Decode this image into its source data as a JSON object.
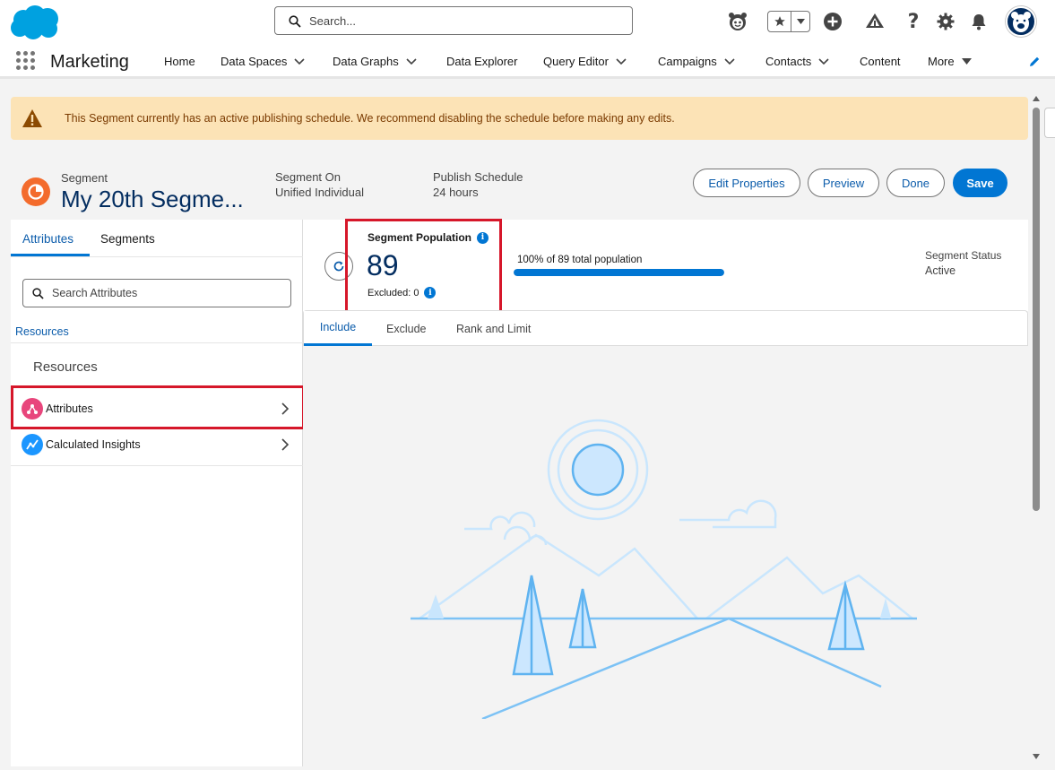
{
  "header": {
    "search_placeholder": "Search...",
    "icons": [
      "salesforce-logo",
      "einstein-icon",
      "favorites-star-icon",
      "add-icon",
      "setup-trailhead-icon",
      "help-icon",
      "gear-icon",
      "notification-bell-icon",
      "user-avatar"
    ]
  },
  "nav": {
    "app_name": "Marketing",
    "items": [
      {
        "label": "Home"
      },
      {
        "label": "Data Spaces"
      },
      {
        "label": "Data Graphs"
      },
      {
        "label": "Data Explorer"
      },
      {
        "label": "Query Editor"
      },
      {
        "label": "Campaigns"
      },
      {
        "label": "Contacts"
      },
      {
        "label": "Content"
      },
      {
        "label": "More"
      }
    ]
  },
  "alert": {
    "text": "This Segment currently has an active publishing schedule. We recommend disabling the schedule before making any edits."
  },
  "record": {
    "type": "Segment",
    "title": "My 20th Segme...",
    "fields": [
      {
        "label": "Segment On",
        "value": "Unified Individual"
      },
      {
        "label": "Publish Schedule",
        "value": "24 hours"
      }
    ],
    "buttons": {
      "edit_properties": "Edit Properties",
      "preview": "Preview",
      "done": "Done",
      "save": "Save"
    }
  },
  "left_panel": {
    "tabs": [
      "Attributes",
      "Segments"
    ],
    "search_placeholder": "Search Attributes",
    "breadcrumb": "Resources",
    "heading": "Resources",
    "items": [
      {
        "label": "Attributes",
        "icon": "attributes-icon",
        "color": "#e8467c"
      },
      {
        "label": "Calculated Insights",
        "icon": "calculated-insights-icon",
        "color": "#1b96ff"
      }
    ]
  },
  "population": {
    "label": "Segment Population",
    "value": "89",
    "excluded": "Excluded: 0",
    "bar_label": "100% of 89 total population",
    "bar_fraction": 1.0,
    "status_label": "Segment Status",
    "status_value": "Active"
  },
  "canvas_tabs": [
    "Include",
    "Exclude",
    "Rank and Limit"
  ],
  "colors": {
    "brand": "#0176d3",
    "highlight": "#d6172a",
    "alert_bg": "#fce3b6"
  }
}
